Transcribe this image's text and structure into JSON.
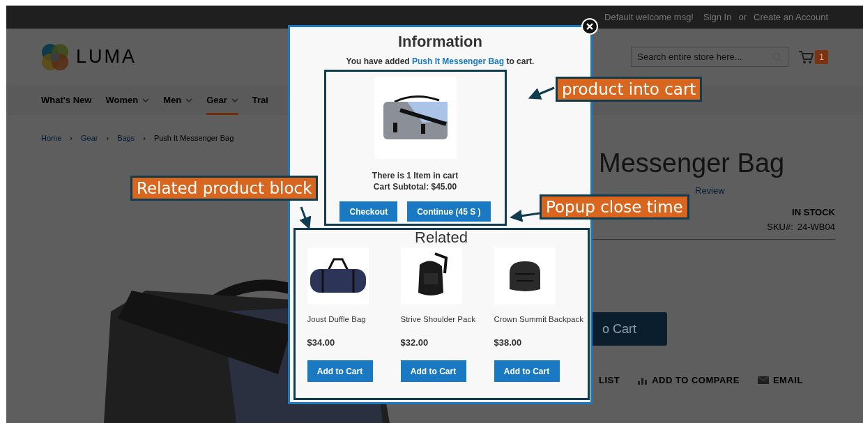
{
  "top_bar": {
    "welcome": "Default welcome msg!",
    "sign_in": "Sign In",
    "separator": "or",
    "create_account": "Create an Account"
  },
  "header": {
    "logo_text": "LUMA",
    "search": {
      "placeholder": "Search entire store here..."
    },
    "cart_count": "1"
  },
  "nav": [
    {
      "label": "What's New",
      "dropdown": false,
      "selected": false
    },
    {
      "label": "Women",
      "dropdown": true,
      "selected": false
    },
    {
      "label": "Men",
      "dropdown": true,
      "selected": false
    },
    {
      "label": "Gear",
      "dropdown": true,
      "selected": true
    },
    {
      "label": "Trai",
      "dropdown": false,
      "selected": false
    }
  ],
  "breadcrumbs": [
    {
      "label": "Home",
      "kind": "link"
    },
    {
      "label": "›",
      "kind": "separator"
    },
    {
      "label": "Gear",
      "kind": "link"
    },
    {
      "label": "›",
      "kind": "separator"
    },
    {
      "label": "Bags",
      "kind": "link"
    },
    {
      "label": "›",
      "kind": "separator"
    },
    {
      "label": "Push It Messenger Bag",
      "kind": "current"
    }
  ],
  "product": {
    "title": "Messenger Bag",
    "review_link": "Review",
    "stock": "IN STOCK",
    "sku_label": "SKU#:",
    "sku": "24-WB04",
    "add_button": "o Cart",
    "actions": [
      {
        "label": "LIST",
        "kind": "none"
      },
      {
        "label": "ADD TO COMPARE",
        "kind": "chart"
      },
      {
        "label": "EMAIL",
        "kind": "mail"
      }
    ]
  },
  "popup": {
    "title": "Information",
    "message_before": "You have added",
    "product_link": "Push It Messenger Bag",
    "message_after": "to cart.",
    "cart_summary": [
      "There is 1 Item in cart",
      "Cart Subtotal: $45.00"
    ],
    "buttons": [
      "Checkout",
      "Continue (45 S )"
    ],
    "related": {
      "title": "Related",
      "items": [
        {
          "name": "Joust Duffle Bag",
          "price": "$34.00",
          "button": "Add to Cart",
          "kind": "duffle"
        },
        {
          "name": "Strive Shoulder Pack",
          "price": "$32.00",
          "button": "Add to Cart",
          "kind": "sling"
        },
        {
          "name": "Crown Summit Backpack",
          "price": "$38.00",
          "button": "Add to Cart",
          "kind": "backpack"
        }
      ]
    }
  },
  "annotations": [
    {
      "text": "product into cart",
      "kind": "cart"
    },
    {
      "text": "Related product block",
      "kind": "related"
    },
    {
      "text": "Popup close time",
      "kind": "timer"
    }
  ]
}
